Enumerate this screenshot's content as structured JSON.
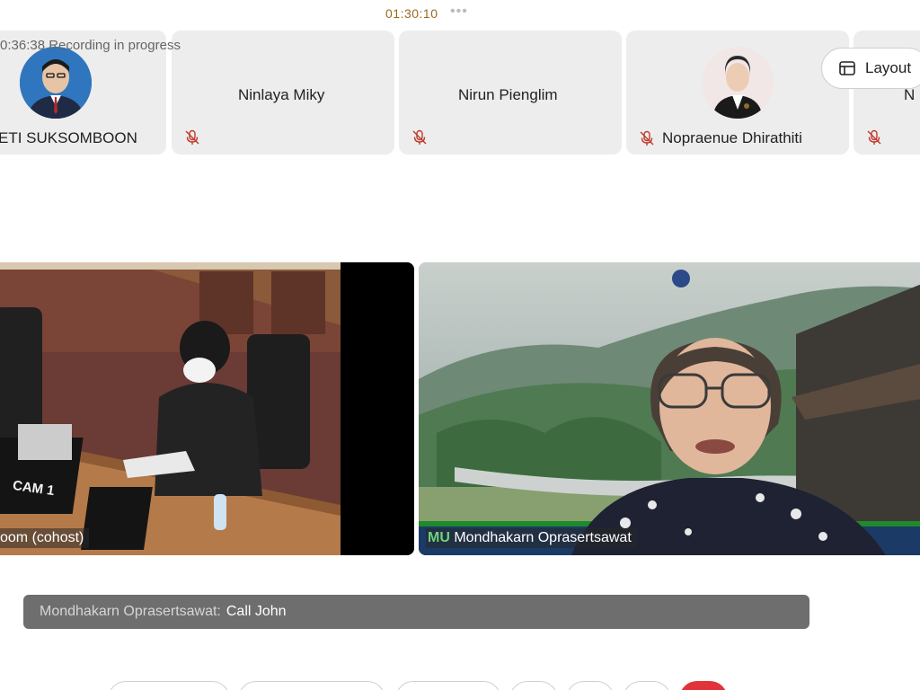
{
  "header": {
    "timer": "01:30:10",
    "more": "•••",
    "recording": "0:36:38 Recording in progress"
  },
  "layout_button": {
    "label": "Layout",
    "icon": "layout-grid-icon"
  },
  "participants": [
    {
      "name": "ETI SUKSOMBOON",
      "mic": "on",
      "has_avatar": true
    },
    {
      "name": "Ninlaya Miky",
      "mic": "muted",
      "has_avatar": false
    },
    {
      "name": "Nirun Pienglim",
      "mic": "muted",
      "has_avatar": false
    },
    {
      "name": "Nopraenue Dhirathiti",
      "mic": "muted",
      "has_avatar": true
    },
    {
      "name": "N",
      "mic": "muted",
      "has_avatar": false
    }
  ],
  "videos": [
    {
      "label": "oom (cohost)",
      "overlay_text": "CAM 1"
    },
    {
      "label": "Mondhakarn Oprasertsawat",
      "logo_text": "MU"
    }
  ],
  "chat_toast": {
    "sender": "Mondhakarn Oprasertsawat:",
    "message": "Call John"
  },
  "colors": {
    "timer": "#9a6a1f",
    "muted_icon": "#c0392b",
    "end_call": "#e0343a",
    "toast_bg": "#6e6e6e"
  }
}
